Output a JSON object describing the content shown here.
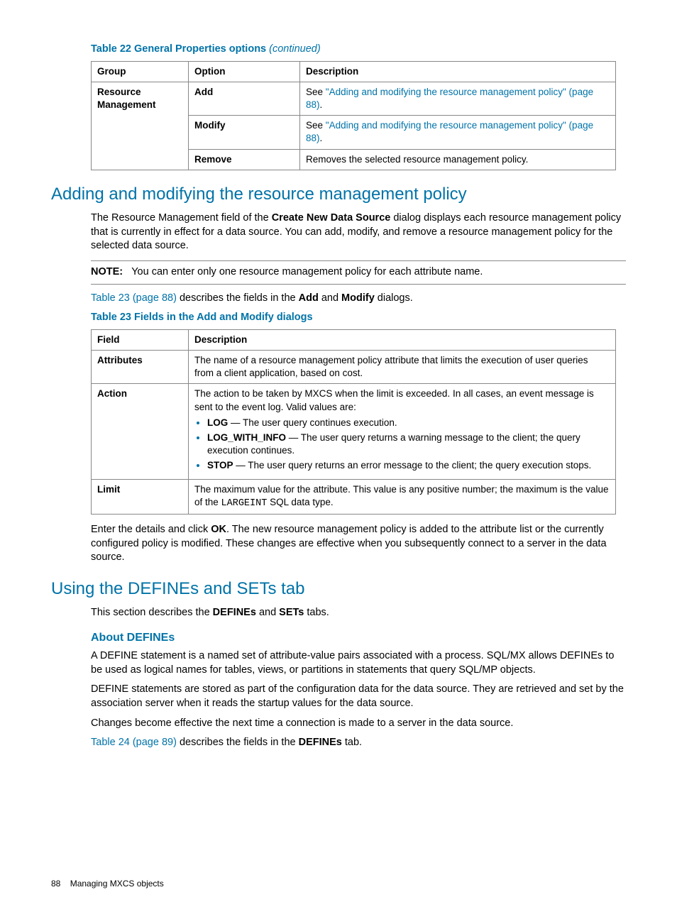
{
  "table22": {
    "caption": "Table 22 General Properties options",
    "continued": "(continued)",
    "headers": {
      "group": "Group",
      "option": "Option",
      "description": "Description"
    },
    "groupLabel": "Resource Management",
    "rows": [
      {
        "option": "Add",
        "see": "See ",
        "linkText": "\"Adding and modifying the resource management policy\" (page 88)",
        "tail": "."
      },
      {
        "option": "Modify",
        "see": "See ",
        "linkText": "\"Adding and modifying the resource management policy\" (page 88)",
        "tail": "."
      },
      {
        "option": "Remove",
        "desc": "Removes the selected resource management policy."
      }
    ]
  },
  "section1": {
    "heading": "Adding and modifying the resource management policy",
    "p1_a": "The Resource Management field of the ",
    "p1_bold": "Create New Data Source",
    "p1_b": " dialog displays each resource management policy that is currently in effect for a data source. You can add, modify, and remove a resource management policy for the selected data source.",
    "noteLabel": "NOTE:",
    "noteText": "You can enter only one resource management policy for each attribute name.",
    "p2_link": "Table 23 (page 88)",
    "p2_mid": " describes the fields in the ",
    "p2_b1": "Add",
    "p2_and": " and ",
    "p2_b2": "Modify",
    "p2_tail": " dialogs."
  },
  "table23": {
    "caption": "Table 23 Fields in the Add and Modify dialogs",
    "headers": {
      "field": "Field",
      "description": "Description"
    },
    "attrRow": {
      "field": "Attributes",
      "desc": "The name of a resource management policy attribute that limits the execution of user queries from a client application, based on cost."
    },
    "actionRow": {
      "field": "Action",
      "intro": "The action to be taken by MXCS when the limit is exceeded. In all cases, an event message is sent to the event log. Valid values are:",
      "log_b": "LOG",
      "log_t": " — The user query continues execution.",
      "lwi_b": "LOG_WITH_INFO",
      "lwi_t": " — The user query returns a warning message to the client; the query execution continues.",
      "stop_b": "STOP",
      "stop_t": " — The user query returns an error message to the client; the query execution stops."
    },
    "limitRow": {
      "field": "Limit",
      "d1": "The maximum value for the attribute. This value is any positive number; the maximum is the value of the ",
      "code": "LARGEINT",
      "d2": " SQL data type."
    }
  },
  "afterTable23": {
    "a": "Enter the details and click ",
    "ok": "OK",
    "b": ". The new resource management policy is added to the attribute list or the currently configured policy is modified. These changes are effective when you subsequently connect to a server in the data source."
  },
  "section2": {
    "heading": "Using the DEFINEs and SETs tab",
    "p1_a": "This section describes the ",
    "p1_b1": "DEFINEs",
    "p1_and": " and ",
    "p1_b2": "SETs",
    "p1_tail": " tabs.",
    "sub": "About DEFINEs",
    "p2": "A DEFINE statement is a named set of attribute-value pairs associated with a process. SQL/MX allows DEFINEs to be used as logical names for tables, views, or partitions in statements that query SQL/MP objects.",
    "p3": "DEFINE statements are stored as part of the configuration data for the data source. They are retrieved and set by the association server when it reads the startup values for the data source.",
    "p4": "Changes become effective the next time a connection is made to a server in the data source.",
    "p5_link": "Table 24 (page 89)",
    "p5_mid": " describes the fields in the ",
    "p5_b": "DEFINEs",
    "p5_tail": " tab."
  },
  "footer": {
    "page": "88",
    "title": "Managing MXCS objects"
  }
}
